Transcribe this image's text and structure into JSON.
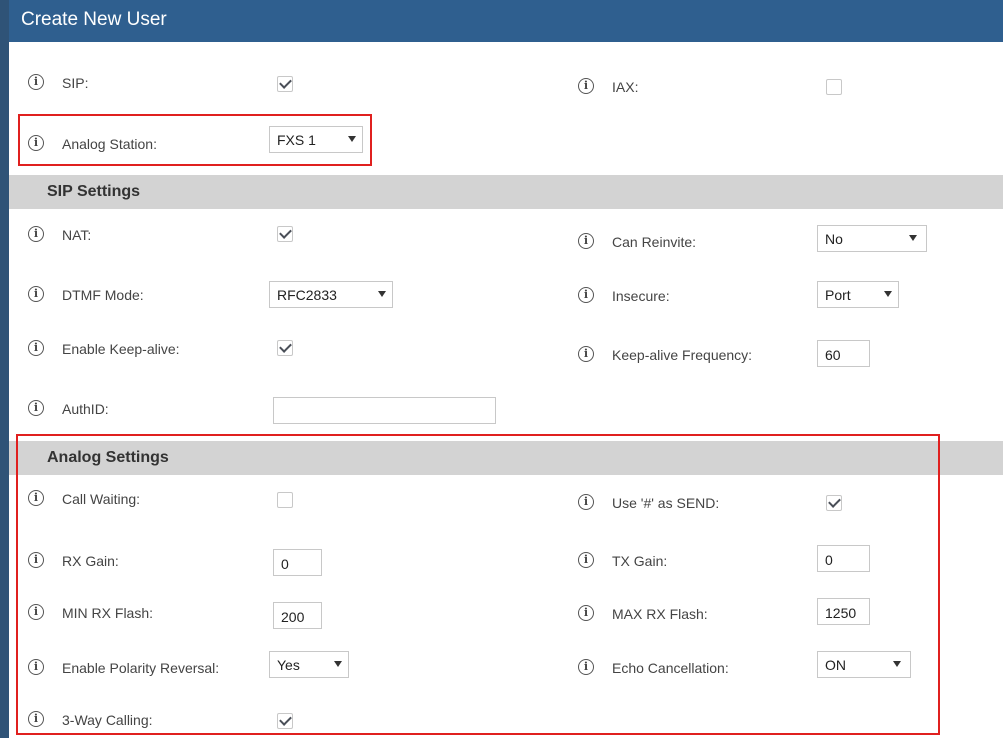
{
  "header": {
    "title": "Create New User"
  },
  "general": {
    "sip": {
      "label": "SIP:",
      "checked": true
    },
    "iax": {
      "label": "IAX:",
      "checked": false
    },
    "analog_station": {
      "label": "Analog Station:",
      "value": "FXS 1"
    }
  },
  "sip_settings": {
    "title": "SIP Settings",
    "nat": {
      "label": "NAT:",
      "checked": true
    },
    "can_reinvite": {
      "label": "Can Reinvite:",
      "value": "No"
    },
    "dtmf_mode": {
      "label": "DTMF Mode:",
      "value": "RFC2833"
    },
    "insecure": {
      "label": "Insecure:",
      "value": "Port"
    },
    "keep_alive": {
      "label": "Enable Keep-alive:",
      "checked": true
    },
    "keep_alive_freq": {
      "label": "Keep-alive Frequency:",
      "value": "60"
    },
    "authid": {
      "label": "AuthID:",
      "value": ""
    }
  },
  "analog_settings": {
    "title": "Analog Settings",
    "call_waiting": {
      "label": "Call Waiting:",
      "checked": false
    },
    "use_hash_send": {
      "label": "Use '#' as SEND:",
      "checked": true
    },
    "rx_gain": {
      "label": "RX Gain:",
      "value": "0"
    },
    "tx_gain": {
      "label": "TX Gain:",
      "value": "0"
    },
    "min_rx_flash": {
      "label": "MIN RX Flash:",
      "value": "200"
    },
    "max_rx_flash": {
      "label": "MAX RX Flash:",
      "value": "1250"
    },
    "polarity_reversal": {
      "label": "Enable Polarity Reversal:",
      "value": "Yes"
    },
    "echo_cancellation": {
      "label": "Echo Cancellation:",
      "value": "ON"
    },
    "three_way_calling": {
      "label": "3-Way Calling:",
      "checked": true
    }
  },
  "icons": {
    "info": "i"
  },
  "colors": {
    "header": "#2f5f8f",
    "section": "#d3d3d3",
    "highlight": "#e0201f"
  }
}
